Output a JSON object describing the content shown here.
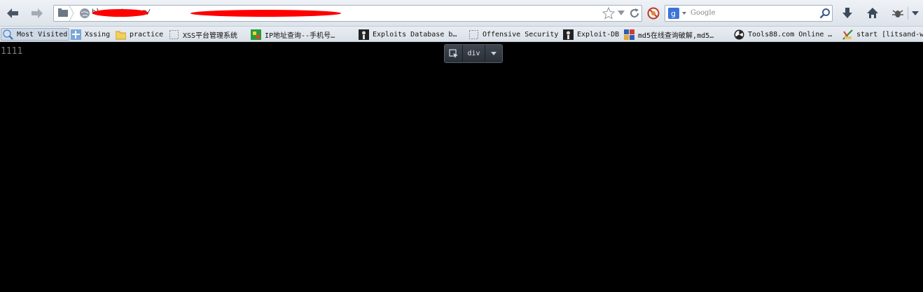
{
  "toolbar": {
    "url_text": "blog.sohu.com/",
    "search_placeholder": "Google"
  },
  "bookmarks": [
    {
      "label": "Most Visited",
      "icon": "globe-search-icon"
    },
    {
      "label": "Xssing",
      "icon": "xssing-icon"
    },
    {
      "label": "practice",
      "icon": "folder-icon"
    },
    {
      "label": "XSS平台管理系统",
      "icon": "blank-page-icon"
    },
    {
      "label": "IP地址查询--手机号…",
      "icon": "ip-icon"
    },
    {
      "label": "Exploits Database b…",
      "icon": "exploit-db-icon"
    },
    {
      "label": "Offensive Security",
      "icon": "blank-page-icon"
    },
    {
      "label": "Exploit-DB",
      "icon": "exploit-db-icon"
    },
    {
      "label": "md5在线查询破解,md5…",
      "icon": "md5-icon"
    },
    {
      "label": "Tools88.com Online …",
      "icon": "radiation-icon"
    },
    {
      "label": "start [litsand-w",
      "icon": "wiki-icon"
    }
  ],
  "page": {
    "text": "1111"
  },
  "inspector": {
    "tag": "div"
  }
}
